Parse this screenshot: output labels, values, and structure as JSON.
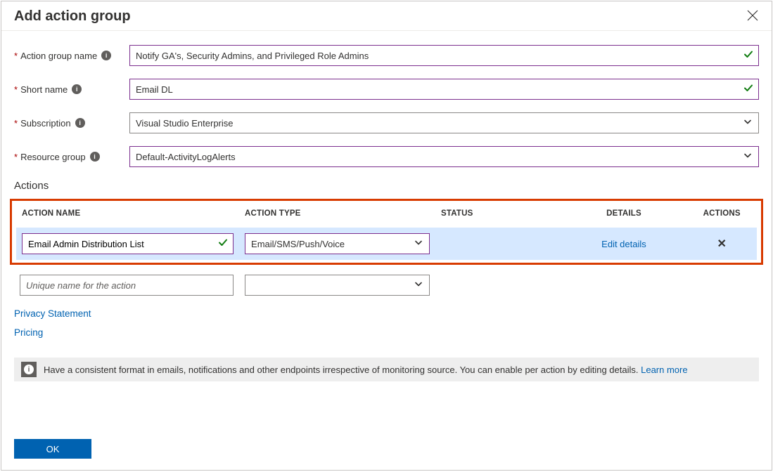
{
  "title": "Add action group",
  "fields": {
    "action_group_name": {
      "label": "Action group name",
      "value": "Notify GA's, Security Admins, and Privileged Role Admins"
    },
    "short_name": {
      "label": "Short name",
      "value": "Email DL"
    },
    "subscription": {
      "label": "Subscription",
      "value": "Visual Studio Enterprise"
    },
    "resource_group": {
      "label": "Resource group",
      "value": "Default-ActivityLogAlerts"
    }
  },
  "actions": {
    "section_label": "Actions",
    "headers": {
      "name": "ACTION NAME",
      "type": "ACTION TYPE",
      "status": "STATUS",
      "details": "DETAILS",
      "actions": "ACTIONS"
    },
    "rows": [
      {
        "name": "Email Admin Distribution List",
        "type": "Email/SMS/Push/Voice",
        "status": "",
        "details_link": "Edit details"
      }
    ],
    "placeholder": "Unique name for the action"
  },
  "links": {
    "privacy": "Privacy Statement",
    "pricing": "Pricing"
  },
  "banner": {
    "text": "Have a consistent format in emails, notifications and other endpoints irrespective of monitoring source. You can enable per action by editing details. ",
    "learn_more": "Learn more"
  },
  "buttons": {
    "ok": "OK"
  }
}
